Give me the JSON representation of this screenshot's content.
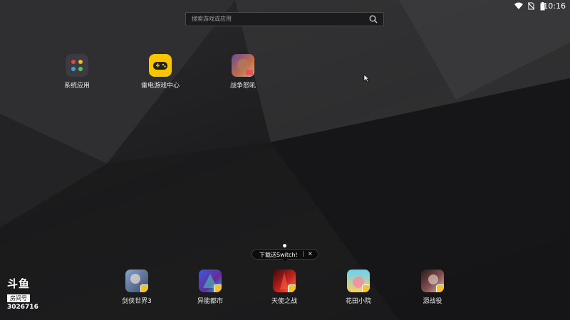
{
  "status": {
    "time": "10:16",
    "icons": [
      "wifi-icon",
      "no-sim-icon",
      "battery-icon"
    ]
  },
  "search": {
    "placeholder": "搜索游戏或应用"
  },
  "desktop_apps": [
    {
      "label": "系统应用",
      "icon": "folder-icon"
    },
    {
      "label": "雷电游戏中心",
      "icon": "gamepad-icon"
    },
    {
      "label": "战争怒吼",
      "icon": "game-icon"
    }
  ],
  "dock_apps": [
    {
      "label": "剑侠世界3",
      "icon": "game-icon"
    },
    {
      "label": "异能都市",
      "icon": "game-icon"
    },
    {
      "label": "天使之战",
      "icon": "game-icon"
    },
    {
      "label": "花田小院",
      "icon": "game-icon"
    },
    {
      "label": "源战役",
      "icon": "game-icon"
    }
  ],
  "tooltip": {
    "text": "下载送Switch!",
    "separator": "|",
    "close": "×"
  },
  "watermark": {
    "logo": "斗鱼",
    "room_label": "房间号",
    "room_number": "3026716"
  },
  "colors": {
    "gamepad_yellow": "#f7c600",
    "badge": "#f2c230"
  }
}
